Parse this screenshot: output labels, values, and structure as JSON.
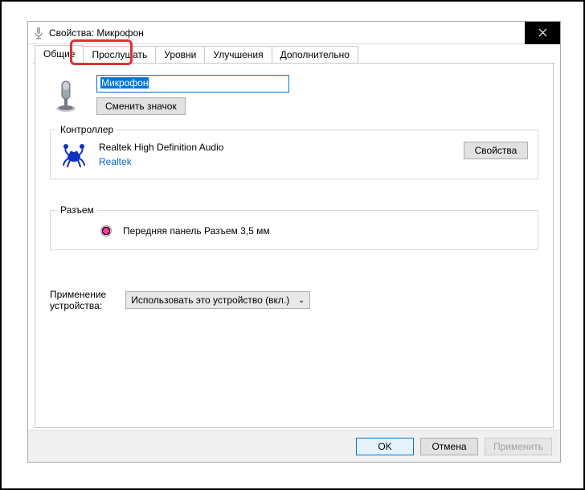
{
  "window": {
    "title": "Свойства: Микрофон"
  },
  "tabs": {
    "general": "Общие",
    "listen": "Прослушать",
    "levels": "Уровни",
    "enhancements": "Улучшения",
    "advanced": "Дополнительно"
  },
  "device": {
    "name_value": "Микрофон",
    "change_icon": "Сменить значок"
  },
  "controller": {
    "group_title": "Контроллер",
    "name": "Realtek High Definition Audio",
    "vendor": "Realtek",
    "properties_btn": "Свойства"
  },
  "jack": {
    "group_title": "Разъем",
    "label": "Передняя панель Разъем 3,5 мм"
  },
  "usage": {
    "label_line1": "Применение",
    "label_line2": "устройства:",
    "value": "Использовать это устройство (вкл.)"
  },
  "footer": {
    "ok": "OK",
    "cancel": "Отмена",
    "apply": "Применить"
  }
}
